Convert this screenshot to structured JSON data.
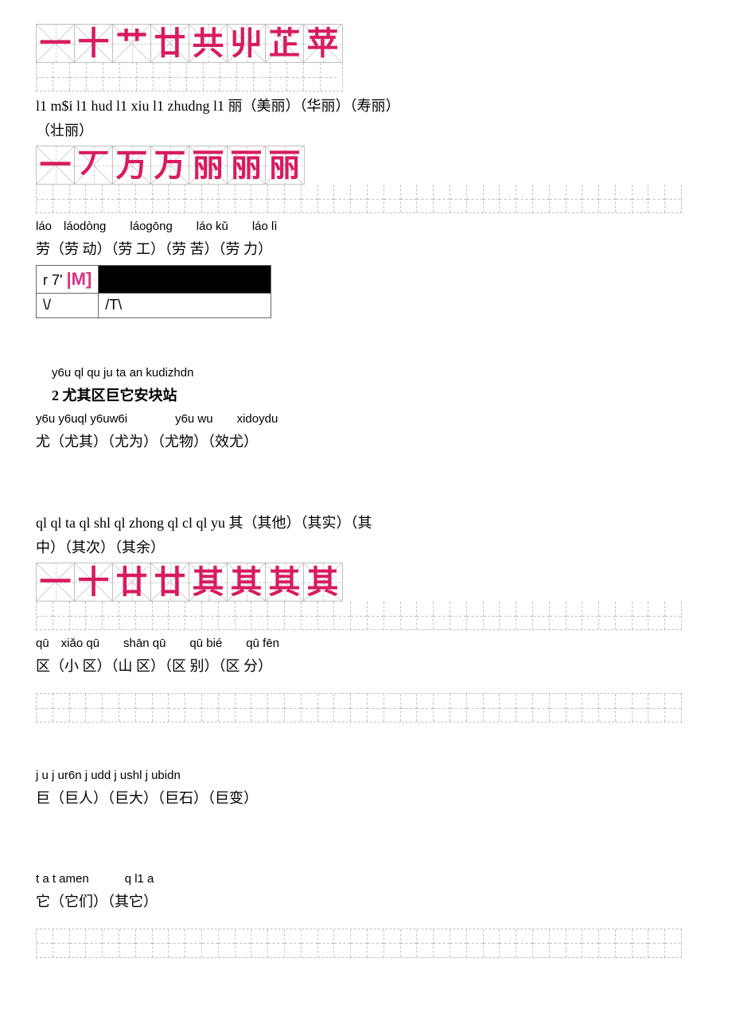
{
  "strokes1": [
    "一",
    "十",
    "艹",
    "廿",
    "共",
    "丱",
    "芷",
    "苹"
  ],
  "line1": "l1 m$i l1 hud l1 xiu l1 zhudng l1 丽（美丽）（华丽）（寿丽）",
  "line2": "（壮丽）",
  "strokes2": [
    "一",
    "丆",
    "万",
    "万",
    "丽",
    "丽",
    "丽"
  ],
  "pinyin_lao": "láo láodòng  láogōng  láo kǔ  láo lì",
  "line_lao": "劳（劳 动）（劳 工）（劳 苦）（劳 力）",
  "odd_r1c1": "r 7'",
  "odd_r1c2": "|M]",
  "odd_r2c1": "\\/",
  "odd_r2c2": "/T\\",
  "pinyin_you_header": "y6u ql qu ju ta an kudizhdn",
  "title2": "2 尤其区巨它安块站",
  "pinyin_you": "y6u y6uql y6uw6i    y6u wu  xidoydu",
  "line_you": "尤（尤其）（尤为）（尤物）（效尤）",
  "line_qi_pinyin": "ql ql ta ql shl ql zhong ql cl ql yu 其（其他）（其实）（其",
  "line_qi2": "中）（其次）（其余）",
  "strokes3": [
    "一",
    "十",
    "廿",
    "廿",
    "其",
    "其",
    "其",
    "其"
  ],
  "pinyin_qu": "qū xiǎo qū  shān qū  qū bié  qū fēn",
  "line_qu": "区（小 区）（山 区）（区 别）（区 分）",
  "pinyin_ju": "j u j ur6n j udd j ushl j ubidn",
  "line_ju": "巨（巨人）（巨大）（巨石）（巨变）",
  "pinyin_ta": "t a t amen   q l1 a",
  "line_ta": "它（它们）（其它）"
}
